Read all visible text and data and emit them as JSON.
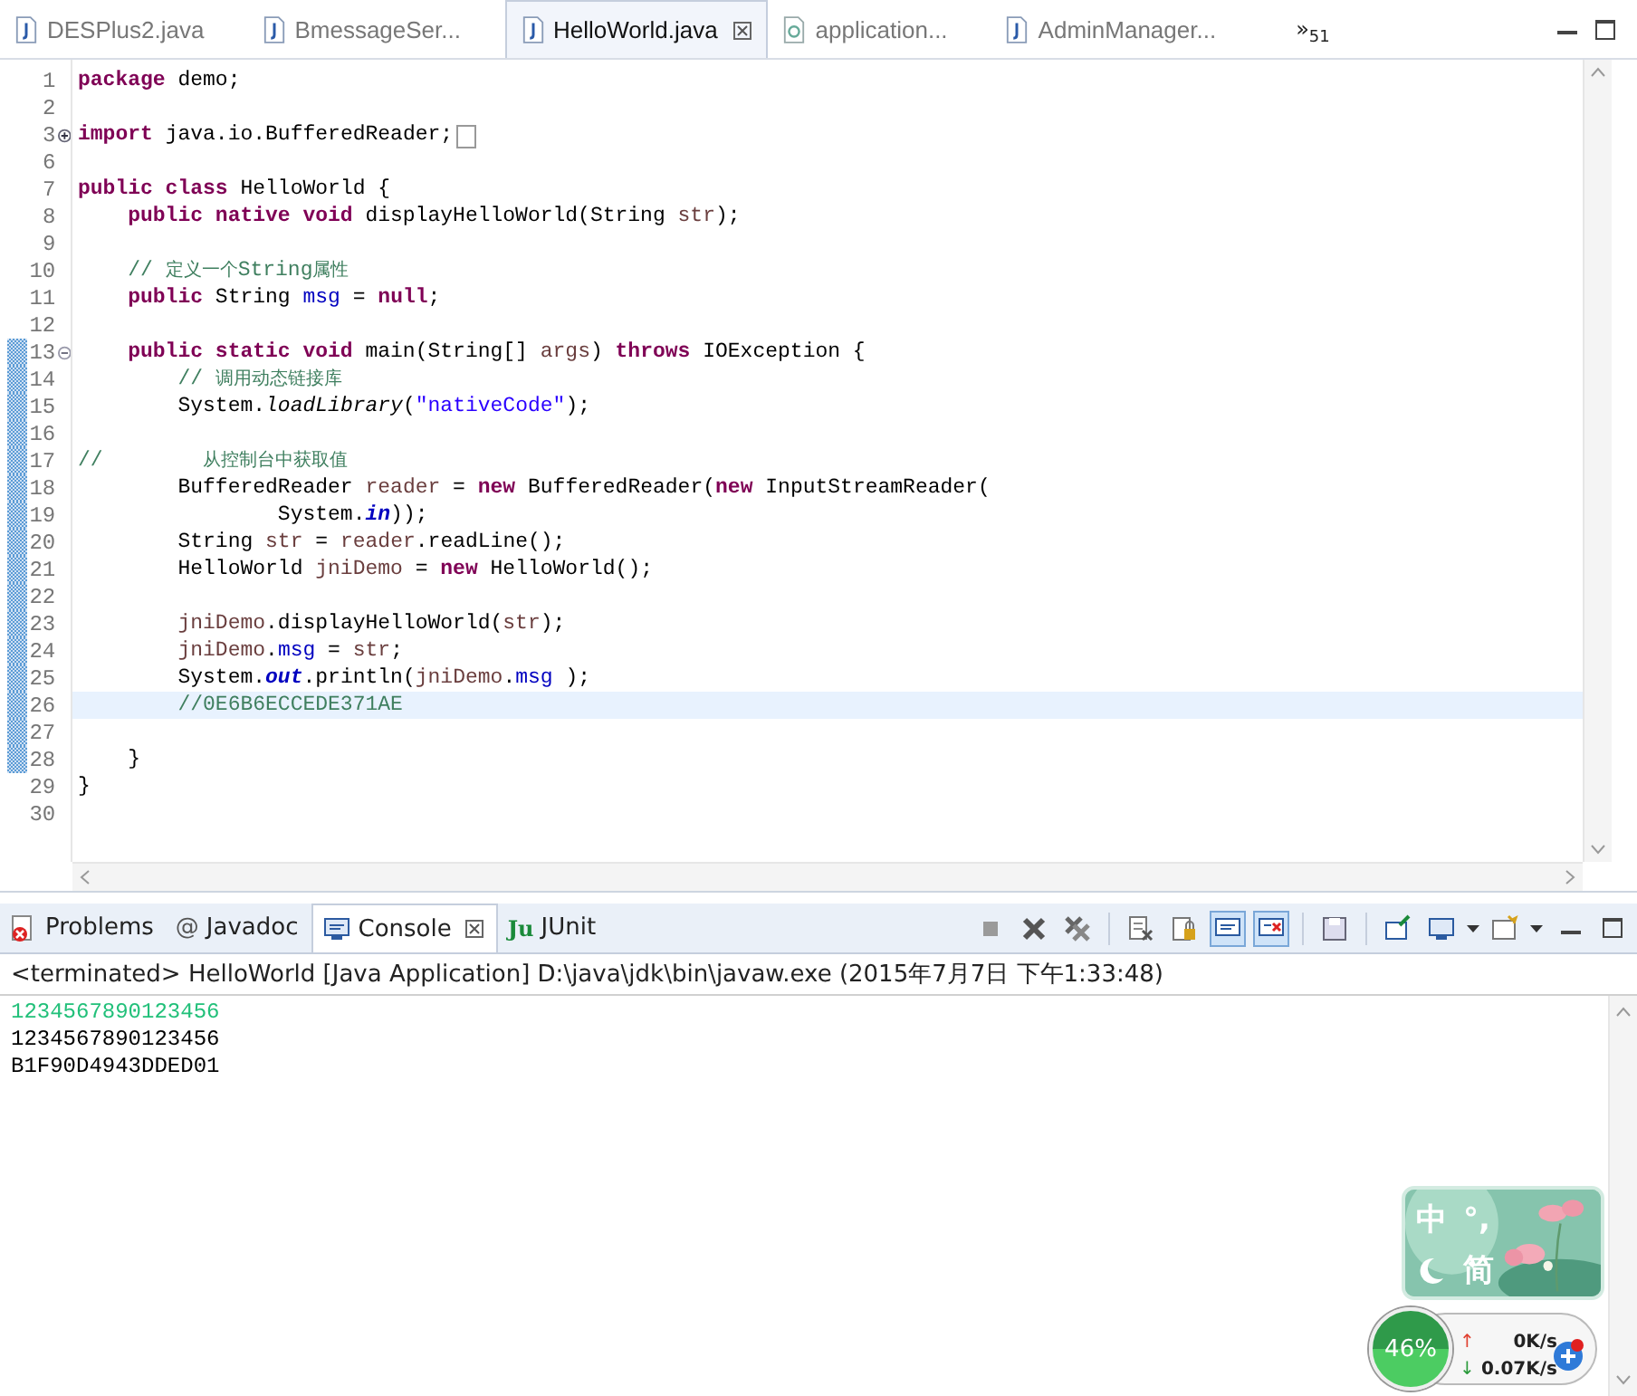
{
  "editor_tabs": [
    {
      "label": "DESPlus2.java",
      "kind": "java",
      "selected": false
    },
    {
      "label": "BmessageSer...",
      "kind": "java",
      "selected": false
    },
    {
      "label": "HelloWorld.java",
      "kind": "java",
      "selected": true
    },
    {
      "label": "application...",
      "kind": "xml",
      "selected": false
    },
    {
      "label": "AdminManager...",
      "kind": "java",
      "selected": false
    }
  ],
  "tabs_overflow": {
    "mark": "»",
    "count": "51"
  },
  "code_lines": [
    {
      "number": "1",
      "changed": false,
      "current": false,
      "folded": false,
      "tokens": [
        {
          "kind": "keyword",
          "text": "package"
        },
        {
          "kind": "plain",
          "text": " demo;"
        }
      ]
    },
    {
      "number": "2",
      "changed": false,
      "current": false,
      "folded": false
    },
    {
      "number": "3",
      "expanded": false,
      "changed": false,
      "current": false,
      "folded": true,
      "tokens": [
        {
          "kind": "keyword",
          "text": "import"
        },
        {
          "kind": "plain",
          "text": " java.io.BufferedReader;"
        }
      ]
    },
    {
      "number": "6",
      "changed": false,
      "current": false,
      "folded": false
    },
    {
      "number": "7",
      "changed": false,
      "current": false,
      "folded": false,
      "tokens": [
        {
          "kind": "keyword",
          "text": "public class"
        },
        {
          "kind": "plain",
          "text": " HelloWorld {"
        }
      ]
    },
    {
      "number": "8",
      "changed": false,
      "current": false,
      "folded": false,
      "tokens": [
        {
          "kind": "keyword",
          "text": "    public native void"
        },
        {
          "kind": "plain",
          "text": " displayHelloWorld(String "
        },
        {
          "kind": "param",
          "text": "str"
        },
        {
          "kind": "plain",
          "text": ");"
        }
      ]
    },
    {
      "number": "9",
      "changed": false,
      "current": false,
      "folded": false
    },
    {
      "number": "10",
      "changed": false,
      "current": false,
      "folded": false,
      "tokens": [
        {
          "kind": "comment",
          "text": "    // "
        },
        {
          "kind": "comment_small",
          "text": "定义一个"
        },
        {
          "kind": "comment",
          "text": "String"
        },
        {
          "kind": "comment_small",
          "text": "属性"
        }
      ]
    },
    {
      "number": "11",
      "changed": false,
      "current": false,
      "folded": false,
      "tokens": [
        {
          "kind": "keyword",
          "text": "    public"
        },
        {
          "kind": "plain",
          "text": " String "
        },
        {
          "kind": "field",
          "text": "msg"
        },
        {
          "kind": "plain",
          "text": " = "
        },
        {
          "kind": "keyword",
          "text": "null"
        },
        {
          "kind": "plain",
          "text": ";"
        }
      ]
    },
    {
      "number": "12",
      "changed": false,
      "current": false,
      "folded": false
    },
    {
      "number": "13",
      "expanded": true,
      "changed": true,
      "current": false,
      "folded": false,
      "tokens": [
        {
          "kind": "keyword",
          "text": "    public static void"
        },
        {
          "kind": "plain",
          "text": " main(String[] "
        },
        {
          "kind": "param",
          "text": "args"
        },
        {
          "kind": "plain",
          "text": ") "
        },
        {
          "kind": "keyword",
          "text": "throws"
        },
        {
          "kind": "plain",
          "text": " IOException {"
        }
      ]
    },
    {
      "number": "14",
      "changed": true,
      "current": false,
      "folded": false,
      "tokens": [
        {
          "kind": "comment",
          "text": "        // "
        },
        {
          "kind": "comment_small",
          "text": "调用动态链接库"
        }
      ]
    },
    {
      "number": "15",
      "changed": true,
      "current": false,
      "folded": false,
      "tokens": [
        {
          "kind": "plain",
          "text": "        System."
        },
        {
          "kind": "static",
          "text": "loadLibrary"
        },
        {
          "kind": "plain",
          "text": "("
        },
        {
          "kind": "string",
          "text": "\"nativeCode\""
        },
        {
          "kind": "plain",
          "text": ");"
        }
      ]
    },
    {
      "number": "16",
      "changed": true,
      "current": false,
      "folded": false
    },
    {
      "number": "17",
      "changed": true,
      "current": false,
      "folded": false,
      "tokens": [
        {
          "kind": "comment",
          "text": "//        "
        },
        {
          "kind": "comment_small",
          "text": "从控制台中获取值"
        }
      ]
    },
    {
      "number": "18",
      "changed": true,
      "current": false,
      "folded": false,
      "tokens": [
        {
          "kind": "plain",
          "text": "        BufferedReader "
        },
        {
          "kind": "param",
          "text": "reader"
        },
        {
          "kind": "plain",
          "text": " = "
        },
        {
          "kind": "keyword",
          "text": "new"
        },
        {
          "kind": "plain",
          "text": " BufferedReader("
        },
        {
          "kind": "keyword",
          "text": "new"
        },
        {
          "kind": "plain",
          "text": " InputStreamReader("
        }
      ]
    },
    {
      "number": "19",
      "changed": true,
      "current": false,
      "folded": false,
      "tokens": [
        {
          "kind": "plain",
          "text": "                System."
        },
        {
          "kind": "static_field",
          "text": "in"
        },
        {
          "kind": "plain",
          "text": "));"
        }
      ]
    },
    {
      "number": "20",
      "changed": true,
      "current": false,
      "folded": false,
      "tokens": [
        {
          "kind": "plain",
          "text": "        String "
        },
        {
          "kind": "param",
          "text": "str"
        },
        {
          "kind": "plain",
          "text": " = "
        },
        {
          "kind": "param",
          "text": "reader"
        },
        {
          "kind": "plain",
          "text": ".readLine();"
        }
      ]
    },
    {
      "number": "21",
      "changed": true,
      "current": false,
      "folded": false,
      "tokens": [
        {
          "kind": "plain",
          "text": "        HelloWorld "
        },
        {
          "kind": "param",
          "text": "jniDemo"
        },
        {
          "kind": "plain",
          "text": " = "
        },
        {
          "kind": "keyword",
          "text": "new"
        },
        {
          "kind": "plain",
          "text": " HelloWorld();"
        }
      ]
    },
    {
      "number": "22",
      "changed": true,
      "current": false,
      "folded": false
    },
    {
      "number": "23",
      "changed": true,
      "current": false,
      "folded": false,
      "tokens": [
        {
          "kind": "param",
          "text": "        jniDemo"
        },
        {
          "kind": "plain",
          "text": ".displayHelloWorld("
        },
        {
          "kind": "param",
          "text": "str"
        },
        {
          "kind": "plain",
          "text": ");"
        }
      ]
    },
    {
      "number": "24",
      "changed": true,
      "current": false,
      "folded": false,
      "tokens": [
        {
          "kind": "param",
          "text": "        jniDemo"
        },
        {
          "kind": "plain",
          "text": "."
        },
        {
          "kind": "field",
          "text": "msg"
        },
        {
          "kind": "plain",
          "text": " = "
        },
        {
          "kind": "param",
          "text": "str"
        },
        {
          "kind": "plain",
          "text": ";"
        }
      ]
    },
    {
      "number": "25",
      "changed": true,
      "current": false,
      "folded": false,
      "tokens": [
        {
          "kind": "plain",
          "text": "        System."
        },
        {
          "kind": "static_field",
          "text": "out"
        },
        {
          "kind": "plain",
          "text": ".println("
        },
        {
          "kind": "param",
          "text": "jniDemo"
        },
        {
          "kind": "plain",
          "text": "."
        },
        {
          "kind": "field",
          "text": "msg"
        },
        {
          "kind": "plain",
          "text": " );"
        }
      ]
    },
    {
      "number": "26",
      "changed": true,
      "current": true,
      "folded": false,
      "tokens": [
        {
          "kind": "comment",
          "text": "        //0E6B6ECCEDE371AE"
        }
      ]
    },
    {
      "number": "27",
      "changed": true,
      "current": false,
      "folded": false
    },
    {
      "number": "28",
      "changed": true,
      "current": false,
      "folded": false,
      "tokens": [
        {
          "kind": "plain",
          "text": "    }"
        }
      ]
    },
    {
      "number": "29",
      "changed": false,
      "current": false,
      "folded": false,
      "tokens": [
        {
          "kind": "plain",
          "text": "}"
        }
      ]
    },
    {
      "number": "30",
      "changed": false,
      "current": false,
      "folded": false
    }
  ],
  "view_tabs": [
    {
      "label": "Problems",
      "kind": "problems",
      "selected": false
    },
    {
      "label": "Javadoc",
      "kind": "javadoc",
      "icon": "@",
      "selected": false
    },
    {
      "label": "Console",
      "kind": "console",
      "selected": true
    },
    {
      "label": "JUnit",
      "kind": "junit",
      "icon": "Ju",
      "selected": false
    }
  ],
  "console_toolbar": [
    {
      "kind": "stop",
      "selected": false
    },
    {
      "kind": "remove",
      "selected": false
    },
    {
      "kind": "remove_all",
      "selected": false
    },
    {
      "kind": "clear",
      "selected": false
    },
    {
      "kind": "lock",
      "selected": false
    },
    {
      "kind": "stdout",
      "selected": true
    },
    {
      "kind": "stderr",
      "selected": true
    },
    {
      "kind": "save",
      "selected": false
    },
    {
      "kind": "pin",
      "selected": false
    },
    {
      "kind": "display",
      "selected": false
    },
    {
      "kind": "open",
      "selected": false
    }
  ],
  "console_header": "<terminated> HelloWorld [Java Application] D:\\java\\jdk\\bin\\javaw.exe (2015年7月7日 下午1:33:48)",
  "console_output": [
    {
      "kind": "input",
      "text": "1234567890123456"
    },
    {
      "kind": "output",
      "text": "1234567890123456"
    },
    {
      "kind": "output",
      "text": "B1F90D4943DDED01"
    }
  ],
  "ime_widget": {
    "language": "中",
    "punctuation": "°,",
    "script": "简"
  },
  "net_widget": {
    "percent": "46%",
    "upload_arrow": "↑",
    "upload": "0K/s",
    "download_arrow": "↓",
    "download": "0.07K/s"
  }
}
